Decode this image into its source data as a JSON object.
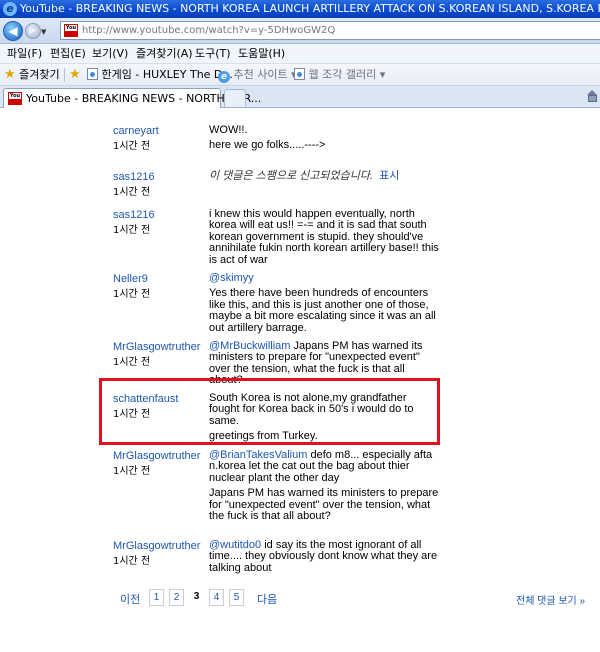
{
  "window": {
    "title": "YouTube - BREAKING NEWS - NORTH KOREA LAUNCH ARTILLERY ATTACK ON S.KOREAN ISLAND, S.KOREA FIRE"
  },
  "address_bar": {
    "url": "http://www.youtube.com/watch?v=y-5DHwoGW2Q"
  },
  "menu": {
    "items": [
      "파일(F)",
      "편집(E)",
      "보기(V)",
      "즐겨찾기(A)",
      "도구(T)",
      "도움말(H)"
    ]
  },
  "favorites_bar": {
    "favorites_label": "즐겨찾기",
    "item1": "한게임 - HUXLEY The D...",
    "item2": "추천 사이트 ▾",
    "item3": "웹 조각 갤러리 ▾"
  },
  "tab": {
    "label": "YouTube - BREAKING NEWS - NORTH KOR..."
  },
  "comments": [
    {
      "user": "carneyart",
      "time": "1시간 전",
      "lines": [
        "WOW!!.",
        "here we go folks.....---->"
      ]
    },
    {
      "user": "sas1216",
      "time": "1시간 전",
      "spam": "이 댓글은 스팸으로 신고되었습니다.",
      "show": "표시"
    },
    {
      "user": "sas1216",
      "time": "1시간 전",
      "lines": [
        "i knew this would happen eventually, north korea will eat us!! =-= and it is sad that south korean government is stupid. they should've annihilate fukin north korean artillery base!! this is act of war"
      ]
    },
    {
      "user": "Neller9",
      "time": "1시간 전",
      "mention": "@skimyy",
      "lines": [
        "Yes there have been hundreds of encounters like this, and this is just another one of those, maybe a bit more escalating since it was an all out artillery barrage."
      ]
    },
    {
      "user": "MrGlasgowtruther",
      "time": "1시간 전",
      "mention": "@MrBuckwilliam",
      "mention_text": "Japans PM has warned its ministers to prepare for \"unexpected event\" over the tension, what the fuck is that all about?"
    },
    {
      "user": "schattenfaust",
      "time": "1시간 전",
      "lines": [
        "South Korea is not alone,my grandfather fought for Korea back in 50's i would do to same.",
        "greetings from Turkey."
      ]
    },
    {
      "user": "MrGlasgowtruther",
      "time": "1시간 전",
      "mention": "@BrianTakesValium",
      "mention_text": "defo m8... especially afta n.korea let the cat out the bag about thier nuclear plant the other day",
      "lines": [
        "Japans PM has warned its ministers to prepare for \"unexpected event\" over the tension, what the fuck is that all about?"
      ]
    },
    {
      "user": "MrGlasgowtruther",
      "time": "1시간 전",
      "mention": "@wutitdo0",
      "mention_text": "id say its the most ignorant of all time.... they obviously dont know what they are talking about"
    }
  ],
  "pagination": {
    "prev": "이전",
    "pages": [
      "1",
      "2",
      "3",
      "4",
      "5"
    ],
    "current": "3",
    "next": "다음",
    "all_comments": "전체 댓글 보기 »"
  }
}
